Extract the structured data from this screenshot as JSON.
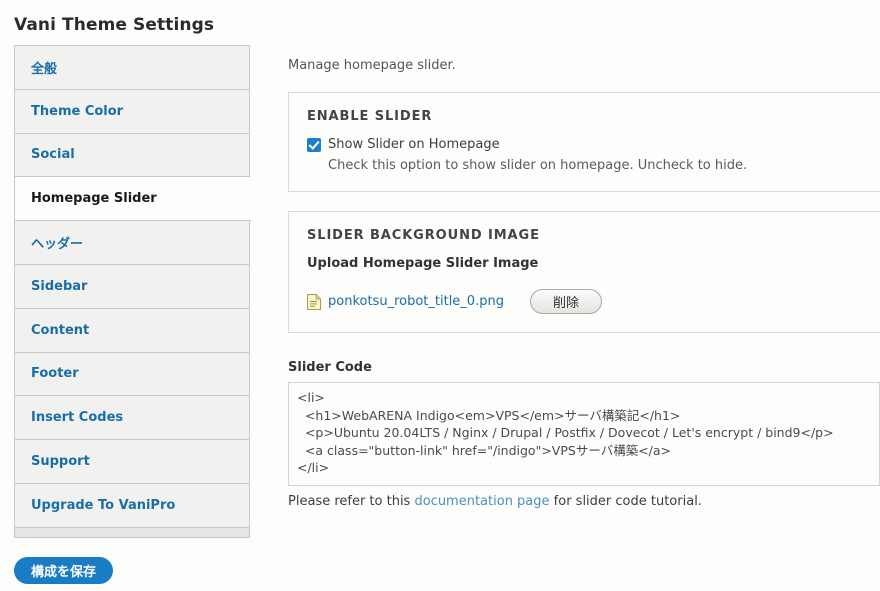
{
  "page": {
    "title": "Vani Theme Settings"
  },
  "sidebar": {
    "items": [
      {
        "label": "全般",
        "active": false
      },
      {
        "label": "Theme Color",
        "active": false
      },
      {
        "label": "Social",
        "active": false
      },
      {
        "label": "Homepage Slider",
        "active": true
      },
      {
        "label": "ヘッダー",
        "active": false
      },
      {
        "label": "Sidebar",
        "active": false
      },
      {
        "label": "Content",
        "active": false
      },
      {
        "label": "Footer",
        "active": false
      },
      {
        "label": "Insert Codes",
        "active": false
      },
      {
        "label": "Support",
        "active": false
      },
      {
        "label": "Upgrade To VaniPro",
        "active": false
      }
    ]
  },
  "main": {
    "intro": "Manage homepage slider.",
    "enable_slider": {
      "heading": "ENABLE SLIDER",
      "checkbox_label": "Show Slider on Homepage",
      "checkbox_checked": true,
      "help": "Check this option to show slider on homepage. Uncheck to hide."
    },
    "background_image": {
      "heading": "SLIDER BACKGROUND IMAGE",
      "field_label": "Upload Homepage Slider Image",
      "file_name": "ponkotsu_robot_title_0.png",
      "file_icon": "document-icon",
      "delete_button": "削除"
    },
    "slider_code": {
      "label": "Slider Code",
      "value": "<li>\n  <h1>WebARENA Indigo<em>VPS</em>サーバ構築記</h1>\n  <p>Ubuntu 20.04LTS / Nginx / Drupal / Postfix / Dovecot / Let's encrypt / bind9</p>\n  <a class=\"button-link\" href=\"/indigo\">VPSサーバ構築</a>\n</li>",
      "help_prefix": "Please refer to this ",
      "help_link": "documentation page",
      "help_suffix": " for slider code tutorial."
    }
  },
  "footer": {
    "save_label": "構成を保存"
  },
  "colors": {
    "link": "#1b6ea5",
    "accent": "#1a7dc4",
    "checkbox": "#1e7ecb",
    "doc_link": "#4a90b8",
    "tab_bg": "#f1f1f0",
    "border": "#c8c8c8"
  }
}
